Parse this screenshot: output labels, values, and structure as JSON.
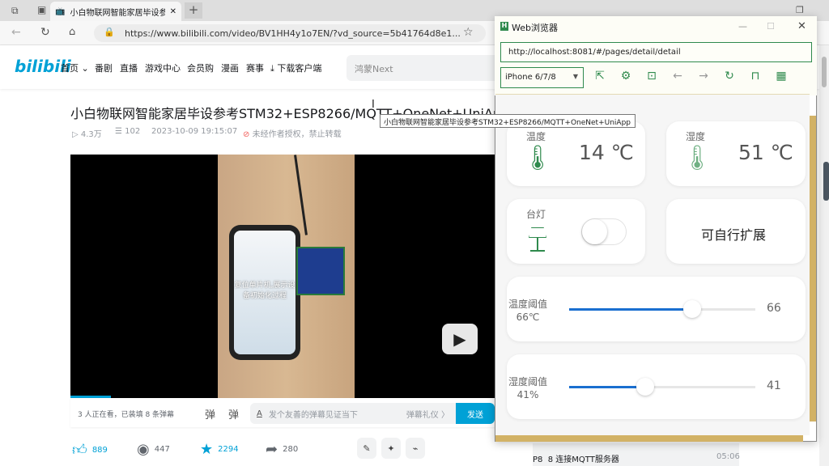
{
  "browser": {
    "tab_title": "小白物联网智能家居毕设参考STM",
    "url": "https://www.bilibili.com/video/BV1HH4y1o7EN/?vd_source=5b41764d8e1..."
  },
  "bilibili": {
    "logo": "bilibili",
    "nav": [
      "首页",
      "番剧",
      "直播",
      "游戏中心",
      "会员购",
      "漫画",
      "赛事",
      "下载客户端"
    ],
    "search_placeholder": "鸿蒙Next",
    "video_title": "小白物联网智能家居毕设参考STM32+ESP8266/MQTT+OneNet+UniApp",
    "views": "4.3万",
    "danmaku_count": "102",
    "date": "2023-10-09 19:15:07",
    "copyright": "未经作者授权，禁止转载",
    "video_caption": "复位单片机,展示设备初始化过程",
    "watching": "3 人正在看，已装填 8 条弹幕",
    "danmaku_placeholder": "发个友善的弹幕见证当下",
    "danmaku_etiquette": "弹幕礼仪 〉",
    "send": "发送",
    "likes": "889",
    "coins": "447",
    "favorites": "2294",
    "shares": "280",
    "playlist_item": {
      "index": "P8",
      "title": "8 连接MQTT服务器",
      "duration": "05:06"
    }
  },
  "tooltip": "小白物联网智能家居毕设参考STM32+ESP8266/MQTT+OneNet+UniApp",
  "hbuilder": {
    "title": "Web浏览器",
    "url": "http://localhost:8081/#/pages/detail/detail",
    "device": "iPhone 6/7/8",
    "cards": {
      "temp_label": "温度",
      "temp_value": "14 ℃",
      "hum_label": "湿度",
      "hum_value": "51 ℃",
      "lamp_label": "台灯",
      "lamp_on": false,
      "expand": "可自行扩展"
    },
    "sliders": [
      {
        "label": "温度阈值",
        "sub": "66℃",
        "value": "66",
        "percent": 66
      },
      {
        "label": "湿度阈值",
        "sub": "41%",
        "value": "41",
        "percent": 41
      }
    ],
    "accent": "#2f8a4d",
    "slider_color": "#1a6fd0"
  }
}
